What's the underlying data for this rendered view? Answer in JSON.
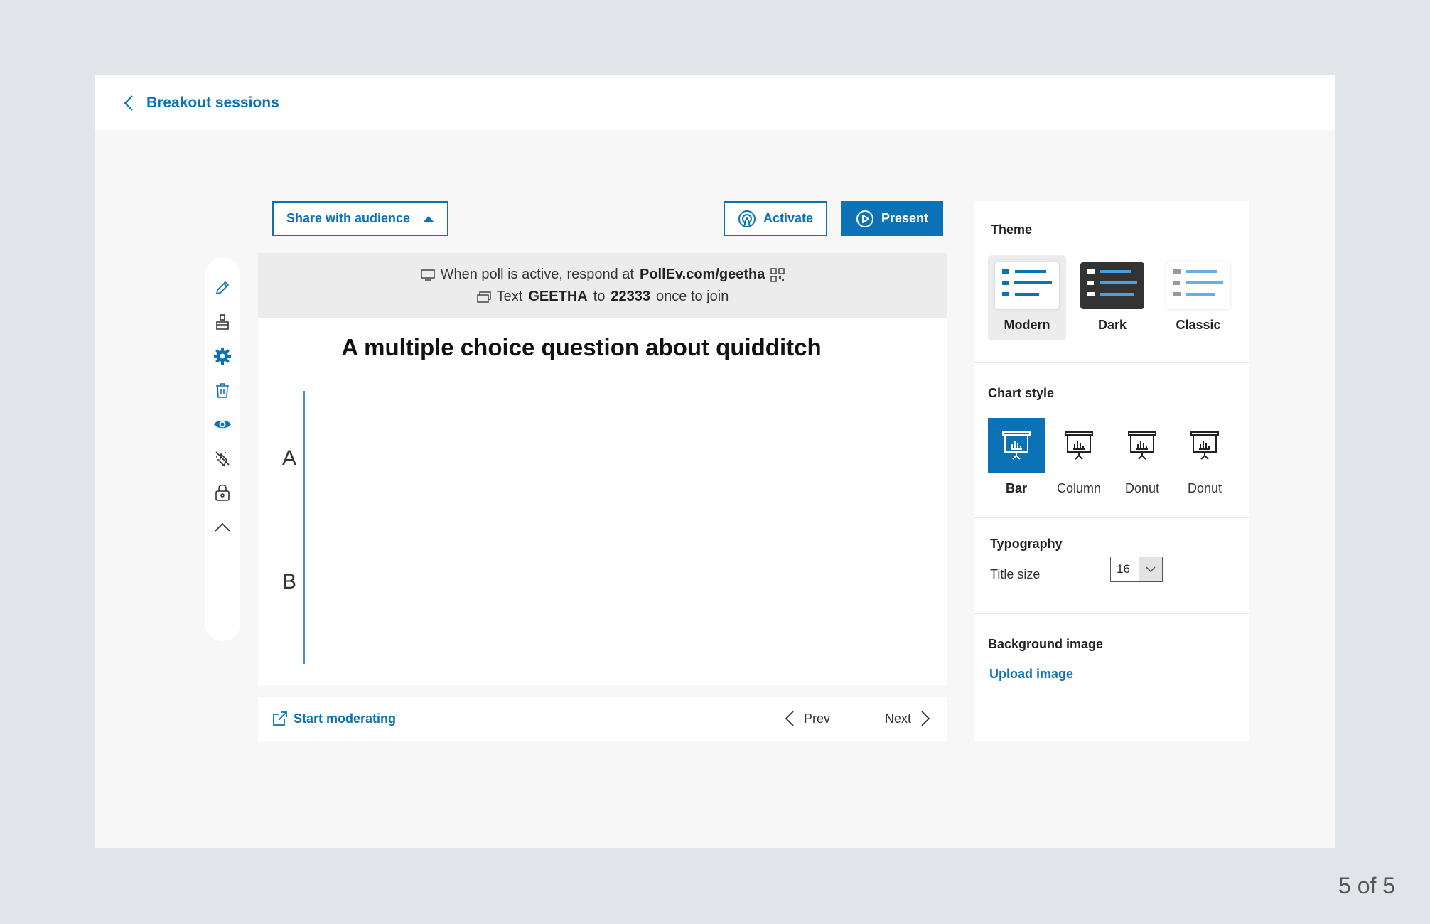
{
  "topbar": {
    "back_label": "Breakout sessions"
  },
  "toolbar": {
    "share_label": "Share with audience",
    "activate_label": "Activate",
    "present_label": "Present"
  },
  "side_tools": [
    "pencil-icon",
    "brush-icon",
    "gear-icon",
    "trash-icon",
    "eye-icon",
    "clear-responses-icon",
    "lock-icon",
    "chevron-up-icon"
  ],
  "slide": {
    "join_line1_prefix": "When poll is active, respond at",
    "join_url": "PollEv.com/geetha",
    "join_line2_text": "Text",
    "join_code": "GEETHA",
    "join_to": "to",
    "join_number": "22333",
    "join_suffix": "once to join",
    "question": "A multiple choice question about quidditch",
    "options": [
      "A",
      "B"
    ]
  },
  "nav": {
    "start_moderating": "Start moderating",
    "prev": "Prev",
    "next": "Next"
  },
  "panel": {
    "theme_title": "Theme",
    "themes": [
      {
        "label": "Modern",
        "selected": true
      },
      {
        "label": "Dark",
        "selected": false
      },
      {
        "label": "Classic",
        "selected": false
      }
    ],
    "chart_style_title": "Chart style",
    "chart_styles": [
      {
        "label": "Bar",
        "selected": true
      },
      {
        "label": "Column",
        "selected": false
      },
      {
        "label": "Donut",
        "selected": false
      },
      {
        "label": "Donut",
        "selected": false
      }
    ],
    "typography_title": "Typography",
    "title_size_label": "Title size",
    "title_size_value": "16",
    "background_title": "Background image",
    "upload_label": "Upload image"
  },
  "colors": {
    "accent": "#0b72b6",
    "dark_theme": "#333333"
  },
  "page_indicator": "5 of 5"
}
